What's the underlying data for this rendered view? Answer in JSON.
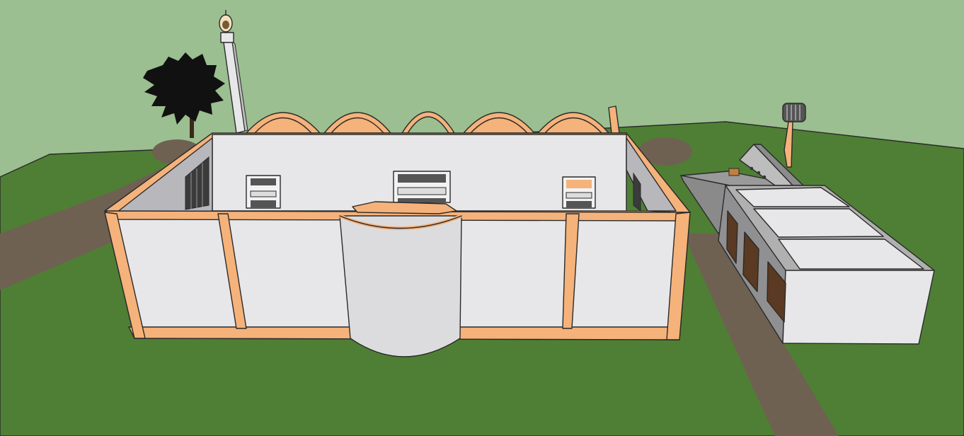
{
  "viewport": {
    "sky_color": "#9bbf90",
    "ground_color": "#4f7f35",
    "path_color": "#6e6152",
    "wall_color": "#e7e7e9",
    "trim_color": "#f5b27a",
    "roof_color": "#f5b27a",
    "window_color": "#3b3b3b",
    "door_color": "#5a3a22"
  },
  "scene": {
    "objects": [
      "ground-plane",
      "footpath",
      "mosque-building",
      "minaret",
      "arched-roof-vaults",
      "entrance-cylinder",
      "tree",
      "ablution-block",
      "water-tank-tower"
    ]
  }
}
